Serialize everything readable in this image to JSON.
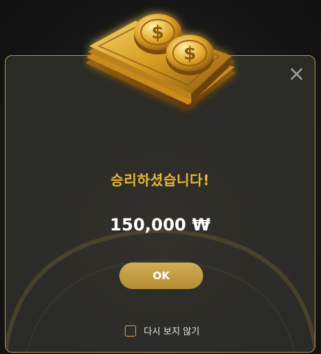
{
  "dialog": {
    "title": "승리하셨습니다!",
    "amount": "150,000 ₩",
    "ok_label": "OK",
    "dont_show_label": "다시 보지 않기",
    "dont_show_checked": false,
    "close_icon": "close-icon",
    "illustration_icon": "gold-coins-cash-icon"
  },
  "colors": {
    "accent": "#e9b634",
    "border": "#b8953f",
    "button": "#c49f46",
    "modal_bg": "#2c2c28",
    "page_bg": "#141414"
  }
}
